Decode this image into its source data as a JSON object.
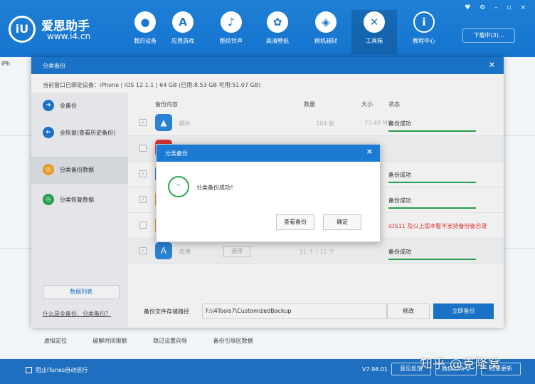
{
  "app": {
    "name": "爱思助手",
    "url": "www.i4.cn",
    "logo_glyph": "iU",
    "download_label": "下载中(3)...",
    "window_controls": "♥ ⚙ – ▫ ×"
  },
  "nav": [
    {
      "label": "我的设备",
      "icon": "apple-icon",
      "glyph": ""
    },
    {
      "label": "应用游戏",
      "icon": "app-store-icon",
      "glyph": "A"
    },
    {
      "label": "酷炫铃声",
      "icon": "bell-icon",
      "glyph": "♪"
    },
    {
      "label": "高清壁纸",
      "icon": "flower-icon",
      "glyph": "✿"
    },
    {
      "label": "刷机越狱",
      "icon": "box-icon",
      "glyph": "◈"
    },
    {
      "label": "工具箱",
      "icon": "tools-icon",
      "glyph": "✕"
    },
    {
      "label": "教程中心",
      "icon": "info-icon",
      "glyph": "i"
    }
  ],
  "background": {
    "tab_label": "iPh",
    "bottom_links": [
      "虚拟定位",
      "破解时间限额",
      "跳过设置向导",
      "备份引导区数据"
    ]
  },
  "dialog": {
    "title": "分类备份",
    "close_glyph": "×",
    "device_info": "当前窗口已绑定设备：iPhone  |  iOS 12.1.1  |  64 GB (已用:8.53 GB 可用:51.07 GB)",
    "sidebar": [
      {
        "label": "全备份",
        "icon": "arrow-right-icon",
        "glyph": "➜",
        "color": "#1b7ad2"
      },
      {
        "label": "全恢复(查看历史备份)",
        "icon": "arrow-left-icon",
        "glyph": "➜",
        "color": "#1b7ad2"
      },
      {
        "label": "分类备份数据",
        "icon": "category-backup-icon",
        "glyph": "◎",
        "color": "#f5a623"
      },
      {
        "label": "分类恢复数据",
        "icon": "category-restore-icon",
        "glyph": "◎",
        "color": "#2aa850"
      }
    ],
    "data_list_label": "数据列表",
    "help_link": "什么是全备份、分类备份？",
    "table": {
      "headers": [
        "备份内容",
        "数量",
        "大小",
        "状态"
      ],
      "rows": [
        {
          "name": "照片",
          "icon": "photo-icon",
          "glyph": "▲",
          "color": "#2d8be0",
          "checked": true,
          "count": "104 张",
          "size": "73.40 MB",
          "status": "备份成功",
          "bar": true,
          "warn": false
        },
        {
          "name": "",
          "icon": "contacts-icon",
          "glyph": "",
          "color": "#e53935",
          "checked": false,
          "count": "",
          "size": "",
          "status": "",
          "bar": false,
          "warn": false
        },
        {
          "name": "",
          "icon": "messages-icon",
          "glyph": "",
          "color": "#2d8be0",
          "checked": true,
          "count": "",
          "size": "",
          "status": "备份成功",
          "bar": true,
          "warn": false
        },
        {
          "name": "",
          "icon": "notes-icon",
          "glyph": "",
          "color": "#f5a623",
          "checked": true,
          "count": "",
          "size": "",
          "status": "备份成功",
          "bar": true,
          "warn": false
        },
        {
          "name": "",
          "icon": "notes-icon",
          "glyph": "",
          "color": "#f5a623",
          "checked": false,
          "count": "",
          "size": "",
          "status": "iOS11 及以上版本暂不支持备份备忘录",
          "bar": false,
          "warn": true
        },
        {
          "name": "应用",
          "icon": "app-store-icon",
          "glyph": "A",
          "color": "#2d8be0",
          "checked": true,
          "count": "11 个 / 11 个",
          "size": "--",
          "status": "备份成功",
          "bar": true,
          "warn": false,
          "select": "选择"
        }
      ]
    },
    "path_label": "备份文件存储路径",
    "path_value": "F:\\i4Tools7\\CustomizedBackup",
    "modify_label": "修改",
    "backup_label": "立即备份"
  },
  "mini_dialog": {
    "title": "分类备份",
    "close_glyph": "×",
    "message": "分类备份成功！",
    "view_label": "查看备份",
    "ok_label": "确定"
  },
  "statusbar": {
    "itunes_label": "阻止iTunes自动运行",
    "version": "V7.98.01",
    "feedback_label": "意见反馈",
    "wechat_label": "微信公众号",
    "update_label": "检查更新"
  },
  "watermark": "知乎 @克隆窝"
}
